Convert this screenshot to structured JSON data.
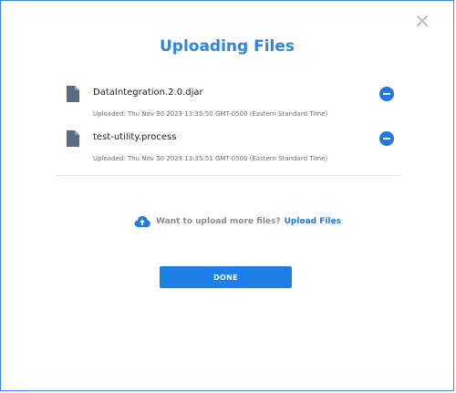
{
  "dialog": {
    "title": "Uploading Files",
    "close_icon": "close-icon"
  },
  "files": [
    {
      "name": "DataIntegration.2.0.djar",
      "uploaded": "Uploaded: Thu Nov 30 2023 13:35:50 GMT-0500 (Eastern Standard Time)",
      "icon": "file-icon",
      "remove_icon": "remove-icon"
    },
    {
      "name": "test-utility.process",
      "uploaded": "Uploaded: Thu Nov 30 2023 13:35:51 GMT-0500 (Eastern Standard Time)",
      "icon": "file-icon",
      "remove_icon": "remove-icon"
    }
  ],
  "upload_more": {
    "icon": "cloud-upload-icon",
    "prompt": "Want to upload more files?",
    "link_label": "Upload Files"
  },
  "actions": {
    "done_label": "DONE"
  },
  "colors": {
    "accent": "#1e7ae0",
    "title": "#2b86e3",
    "border": "#3a86e6",
    "muted": "#8a8f97",
    "file_icon": "#5b6b84"
  }
}
